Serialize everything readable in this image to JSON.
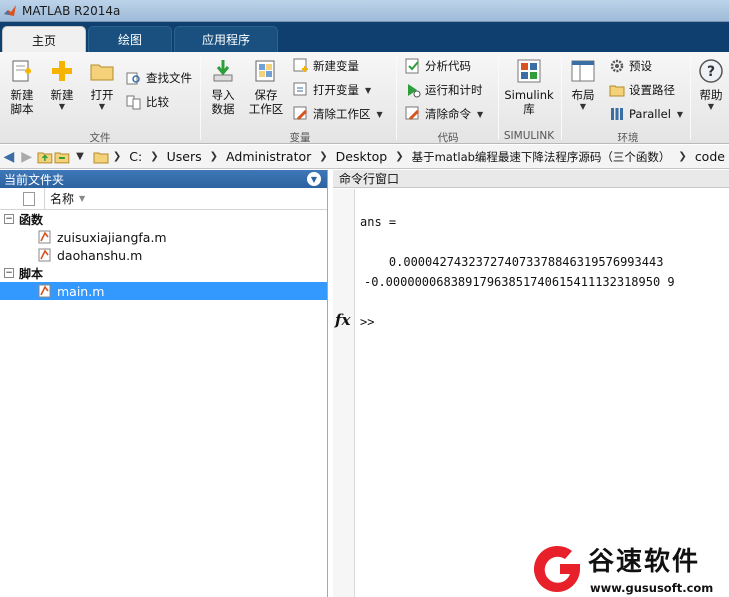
{
  "window": {
    "title": "MATLAB R2014a"
  },
  "tabs": [
    {
      "label": "主页",
      "active": true
    },
    {
      "label": "绘图",
      "active": false
    },
    {
      "label": "应用程序",
      "active": false
    }
  ],
  "ribbon": {
    "file": {
      "new_script": "新建\n脚本",
      "new": "新建",
      "open": "打开",
      "find_files": "查找文件",
      "compare": "比较",
      "group_label": "文件"
    },
    "variable": {
      "import_data": "导入\n数据",
      "save_workspace": "保存\n工作区",
      "new_variable": "新建变量",
      "open_variable": "打开变量",
      "clear_workspace": "清除工作区",
      "group_label": "变量"
    },
    "code": {
      "analyze_code": "分析代码",
      "run_and_time": "运行和计时",
      "clear_commands": "清除命令",
      "group_label": "代码"
    },
    "simulink": {
      "library": "Simulink\n库",
      "group_label": "SIMULINK"
    },
    "environment": {
      "layout": "布局",
      "preferences": "预设",
      "set_path": "设置路径",
      "parallel": "Parallel",
      "group_label": "环境"
    },
    "resources": {
      "help": "帮助"
    }
  },
  "address": {
    "path": [
      "C:",
      "Users",
      "Administrator",
      "Desktop",
      "基于matlab编程最速下降法程序源码（三个函数）",
      "code"
    ]
  },
  "current_folder": {
    "title": "当前文件夹",
    "column_name": "名称",
    "groups": [
      {
        "label": "函数",
        "items": [
          "zuisuxiajiangfa.m",
          "daohanshu.m"
        ]
      },
      {
        "label": "脚本",
        "items": [
          "main.m"
        ]
      }
    ],
    "selected": "main.m"
  },
  "command_window": {
    "title": "命令行窗口",
    "lines": [
      "ans =",
      "    0.000042743237274073378846319576993443",
      "-0.00000006838917963851740615411132318950 9"
    ],
    "prompt": ">>"
  },
  "watermark": {
    "title": "谷速软件",
    "url": "www.gususoft.com"
  },
  "colors": {
    "tab_strip": "#0f3f6e",
    "panel_header": "#2d62a0",
    "selection": "#3399ff",
    "watermark_red": "#e8202a"
  }
}
